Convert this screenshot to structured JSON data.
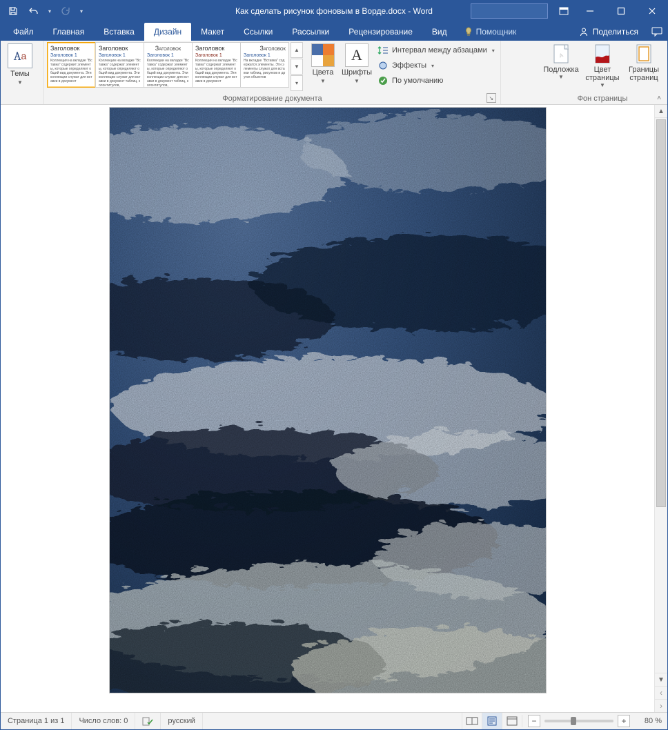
{
  "title": {
    "document": "Как сделать рисунок фоновым в Ворде.docx",
    "sep": "  -  ",
    "app": "Word"
  },
  "tabs": {
    "file": "Файл",
    "items": [
      "Главная",
      "Вставка",
      "Дизайн",
      "Макет",
      "Ссылки",
      "Рассылки",
      "Рецензирование",
      "Вид"
    ],
    "active_index": 2,
    "tell_me": "Помощник",
    "share": "Поделиться"
  },
  "ribbon": {
    "themes": {
      "label": "Темы"
    },
    "style_gallery": {
      "items": [
        {
          "heading": "Заголовок",
          "sub": "Заголовок 1",
          "body": "Коллекция на вкладке \"Вставка\" содержит элементы, которые определяют общий вид документа. Эти коллекции служат для вставки в документ"
        },
        {
          "heading": "Заголовок",
          "sub": "Заголовок 1",
          "body": "Коллекции на вкладке \"Вставка\" содержат элементы, которые определяют общий вид документа. Эти коллекции служат для вставки в документ таблиц, колонтитулов,"
        },
        {
          "heading": "Заголовок",
          "sub": "Заголовок 1",
          "body": "Коллекции на вкладке \"Вставка\" содержат элементы, которые определяют общий вид документа. Эти коллекции служат для вставки в документ таблиц, колонтитулов,"
        },
        {
          "heading": "Заголовок",
          "sub": "Заголовок 1",
          "body": "Коллекции на вкладке \"Вставка\" содержат элементы, которые определяют общий вид документа. Эти коллекции служат для вставки в документ"
        },
        {
          "heading": "Заголовок",
          "sub": "Заголовок 1",
          "body": "На вкладке \"Вставка\" содержатся элементы. Эти элементы служат для вставки таблиц, рисунков и других объектов"
        }
      ],
      "group_label": "Форматирование документа"
    },
    "colors": {
      "label": "Цвета"
    },
    "fonts": {
      "label": "Шрифты"
    },
    "paragraph_spacing": "Интервал между абзацами",
    "effects": "Эффекты",
    "set_default": "По умолчанию",
    "page_background": {
      "watermark": "Подложка",
      "page_color": "Цвет страницы",
      "page_borders": "Границы страниц",
      "group_label": "Фон страницы"
    }
  },
  "statusbar": {
    "page": "Страница 1 из 1",
    "words": "Число слов: 0",
    "language": "русский",
    "zoom": "80 %"
  }
}
